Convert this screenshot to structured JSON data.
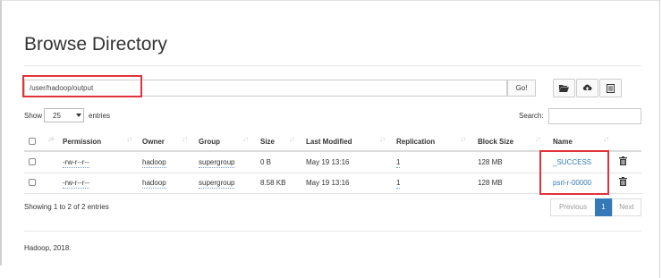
{
  "page": {
    "title": "Browse Directory"
  },
  "path_bar": {
    "value": "/user/hadoop/output",
    "go_label": "Go!"
  },
  "toolbar": {
    "buttons": [
      {
        "name": "folder-open-icon"
      },
      {
        "name": "upload-cloud-icon"
      },
      {
        "name": "list-file-icon"
      }
    ]
  },
  "table_controls": {
    "show_label": "Show",
    "page_length": "25",
    "entries_label": "entries",
    "search_label": "Search:"
  },
  "table": {
    "columns": [
      "Permission",
      "Owner",
      "Group",
      "Size",
      "Last Modified",
      "Replication",
      "Block Size",
      "Name"
    ],
    "rows": [
      {
        "permission": "-rw-r--r--",
        "owner": "hadoop",
        "group": "supergroup",
        "size": "0 B",
        "last_modified": "May 19 13:16",
        "replication": "1",
        "block_size": "128 MB",
        "name": "_SUCCESS"
      },
      {
        "permission": "-rw-r--r--",
        "owner": "hadoop",
        "group": "supergroup",
        "size": "8.58 KB",
        "last_modified": "May 19 13:16",
        "replication": "1",
        "block_size": "128 MB",
        "name": "psrl-r-00000"
      }
    ]
  },
  "info": "Showing 1 to 2 of 2 entries",
  "pagination": {
    "previous": "Previous",
    "current": "1",
    "next": "Next"
  },
  "footer": "Hadoop, 2018.",
  "colors": {
    "annotation_red": "#e2323b",
    "link_blue": "#337ab7"
  }
}
